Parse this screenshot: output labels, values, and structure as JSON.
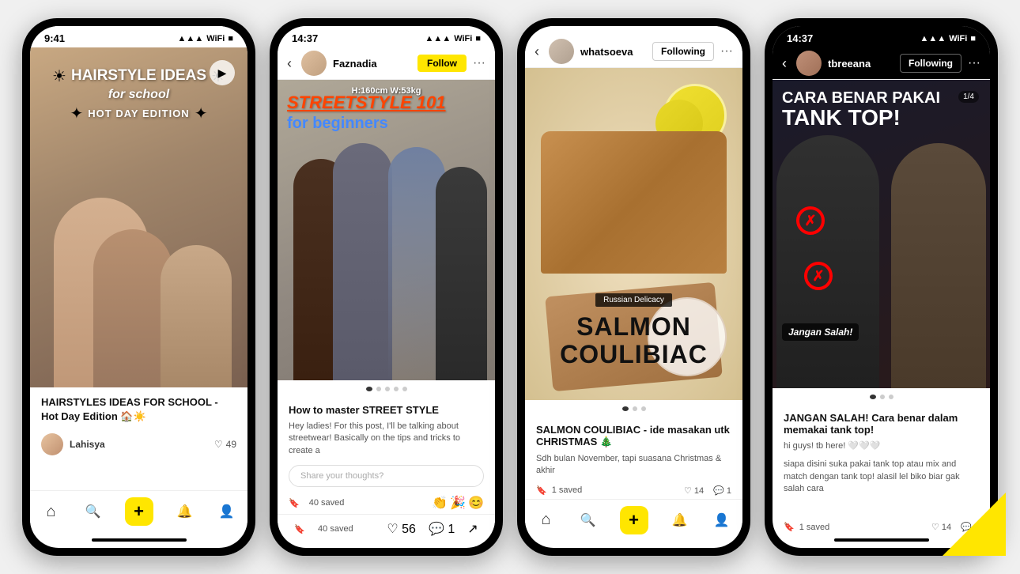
{
  "phones": [
    {
      "id": "phone1",
      "statusBar": {
        "time": "9:41",
        "signal": "▲▲▲",
        "wifi": "WiFi",
        "battery": "100"
      },
      "image": {
        "title1": "HAIRSTYLE IDEAS",
        "title2": "for school",
        "title3": "HOT DAY EDITION",
        "hasPlay": true
      },
      "caption": "HAIRSTYLES IDEAS FOR SCHOOL - Hot Day Edition 🏠☀️",
      "author": "Lahisya",
      "likes": "49",
      "nav": [
        "home",
        "search",
        "add",
        "bell",
        "person"
      ]
    },
    {
      "id": "phone2",
      "statusBar": {
        "time": "14:37",
        "signal": "▲▲▲",
        "wifi": "WiFi",
        "battery": "100"
      },
      "nav_back": "‹",
      "username": "Faznadia",
      "followBtn": "Follow",
      "heightInfo": "H:160cm W:53kg",
      "image": {
        "title1": "STREETSTYLE 101",
        "title2": "for beginners"
      },
      "postTitle": "How to master STREET STYLE",
      "postText": "Hey ladies! For this post, I'll be talking about streetwear! Basically on the tips and tricks to create a",
      "commentPlaceholder": "Share your thoughts?",
      "saved": "40 saved",
      "likes": "56",
      "comments": "1",
      "emojis": [
        "👏",
        "🎉",
        "😊"
      ]
    },
    {
      "id": "phone3",
      "statusBar": {
        "time": "",
        "signal": "",
        "wifi": "",
        "battery": ""
      },
      "nav_back": "‹",
      "username": "whatsoeva",
      "followingBtn": "Following",
      "image": {
        "russianBadge": "Russian Delicacy",
        "title1": "SALMON",
        "title2": "COULIBIAC"
      },
      "postTitle": "SALMON COULIBIAC - ide masakan utk CHRISTMAS 🎄",
      "postText": "Sdh bulan November, tapi suasana Christmas & akhir",
      "saved": "1 saved",
      "likes": "14",
      "comments": "1",
      "nav": [
        "home",
        "search",
        "add",
        "bell",
        "person"
      ]
    },
    {
      "id": "phone4",
      "statusBar": {
        "time": "14:37",
        "signal": "▲▲▲",
        "wifi": "WiFi",
        "battery": "100",
        "dark": true
      },
      "nav_back": "‹",
      "username": "tbreeana",
      "followingBtn": "Following",
      "slideCounter": "1/4",
      "image": {
        "title1": "CARA BENAR PAKAI",
        "title2": "TANK TOP!",
        "janganLabel": "Jangan Salah!"
      },
      "postTitle": "JANGAN SALAH! Cara benar dalam memakai tank top!",
      "postText": "hi guys! tb here! 🤍🤍🤍",
      "postText2": "siapa disini suka pakai tank top atau mix and match dengan tank top! alasil lel biko biar gak salah cara",
      "saved": "1 saved",
      "likes": "14",
      "comments": "1",
      "hasYellowTriangle": true
    }
  ],
  "icons": {
    "home": "⌂",
    "search": "🔍",
    "add": "+",
    "bell": "🔔",
    "person": "👤",
    "heart": "♡",
    "bookmark": "🔖",
    "share": "↗",
    "comment": "💬",
    "back": "‹",
    "dots": "···"
  }
}
